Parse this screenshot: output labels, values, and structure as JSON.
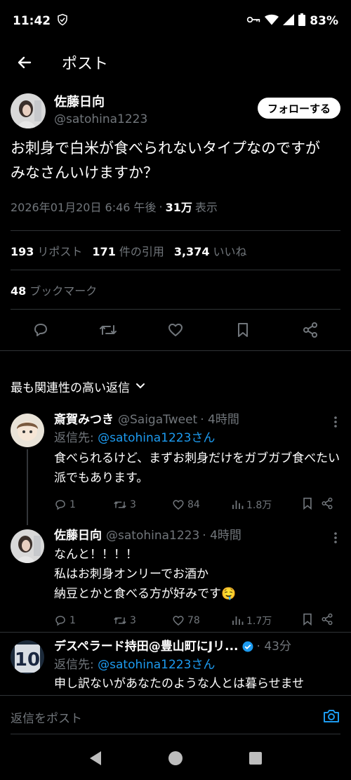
{
  "status": {
    "time": "11:42",
    "battery": "83%"
  },
  "header": {
    "title": "ポスト"
  },
  "post": {
    "author_name": "佐藤日向",
    "author_handle": "@satohina1223",
    "follow_label": "フォローする",
    "text": "お刺身で白米が食べられないタイプなのですが\nみなさんいけますか？",
    "timestamp": "2026年01月20日 6:46 午後",
    "views": "31万",
    "views_label": "表示",
    "reposts": "193",
    "reposts_label": "リポスト",
    "quotes": "171",
    "quotes_label": "件の引用",
    "likes": "3,374",
    "likes_label": "いいね",
    "bookmarks": "48",
    "bookmarks_label": "ブックマーク"
  },
  "sort": {
    "label": "最も関連性の高い返信"
  },
  "replies": [
    {
      "name": "斎賀みつき",
      "handle": "@SaigaTweet",
      "time": "· 4時間",
      "replyto_prefix": "返信先: ",
      "replyto_user": "@satohina1223さん",
      "text": "食べられるけど、まずお刺身だけをガブガブ食べたい派でもあります。",
      "replies": "1",
      "reposts": "3",
      "likes": "84",
      "views": "1.8万"
    },
    {
      "name": "佐藤日向",
      "handle": "@satohina1223",
      "time": "· 4時間",
      "text": "なんと！！！！\n私はお刺身オンリーでお酒か\n納豆とかと食べる方が好みです🤤",
      "replies": "1",
      "reposts": "3",
      "likes": "78",
      "views": "1.7万"
    },
    {
      "name": "デスペラード持田@豊山町にJリ...",
      "time": "· 43分",
      "replyto_prefix": "返信先: ",
      "replyto_user": "@satohina1223さん",
      "text": "申し訳ないがあなたのような人とは暮らせませ"
    }
  ],
  "reply_bar": {
    "placeholder": "返信をポスト"
  },
  "colors": {
    "accent": "#1d9bf0",
    "muted": "#71767b",
    "background": "#000000"
  }
}
